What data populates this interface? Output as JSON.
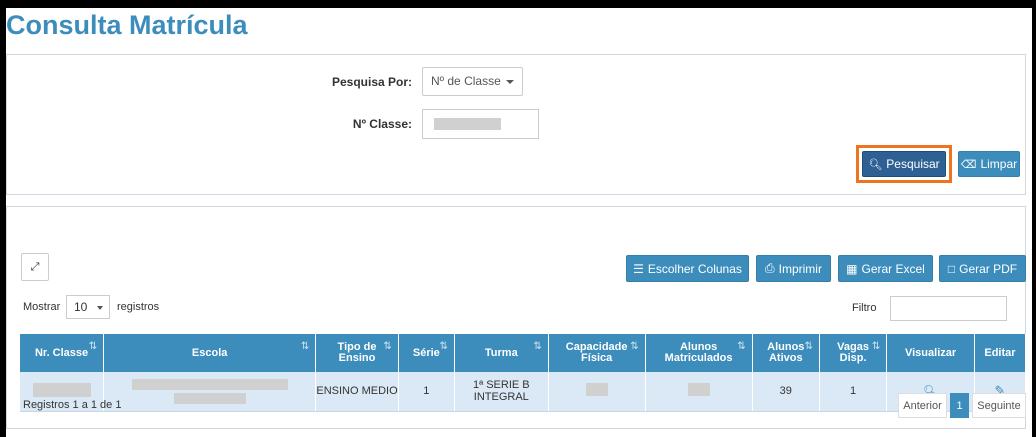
{
  "page_title": "Consulta Matrícula",
  "search": {
    "search_by_label": "Pesquisa Por:",
    "search_by_value": "Nº de Classe",
    "class_number_label": "Nº Classe:",
    "search_button": "Pesquisar",
    "clear_button": "Limpar"
  },
  "toolbar": {
    "expand_icon": "expand-icon",
    "choose_columns": "Escolher Colunas",
    "print": "Imprimir",
    "excel": "Gerar Excel",
    "pdf": "Gerar PDF"
  },
  "list_controls": {
    "show_label": "Mostrar",
    "page_size": "10",
    "records_label": "registros",
    "filter_label": "Filtro"
  },
  "table": {
    "headers": [
      "Nr. Classe",
      "Escola",
      "Tipo de Ensino",
      "Série",
      "Turma",
      "Capacidade Física",
      "Alunos Matriculados",
      "Alunos Ativos",
      "Vagas Disp.",
      "Visualizar",
      "Editar"
    ],
    "rows": [
      {
        "tipo_ensino": "ENSINO MEDIO",
        "serie": "1",
        "turma": "1ª SERIE B INTEGRAL",
        "alunos_ativos": "39",
        "vagas": "1"
      }
    ]
  },
  "footer": {
    "summary": "Registros 1 a 1 de 1",
    "previous": "Anterior",
    "current_page": "1",
    "next": "Seguinte"
  },
  "colors": {
    "primary": "#3c8dbc",
    "dark_button": "#2e6094",
    "highlight": "#f0741f",
    "row_bg": "#dbe9f6"
  }
}
